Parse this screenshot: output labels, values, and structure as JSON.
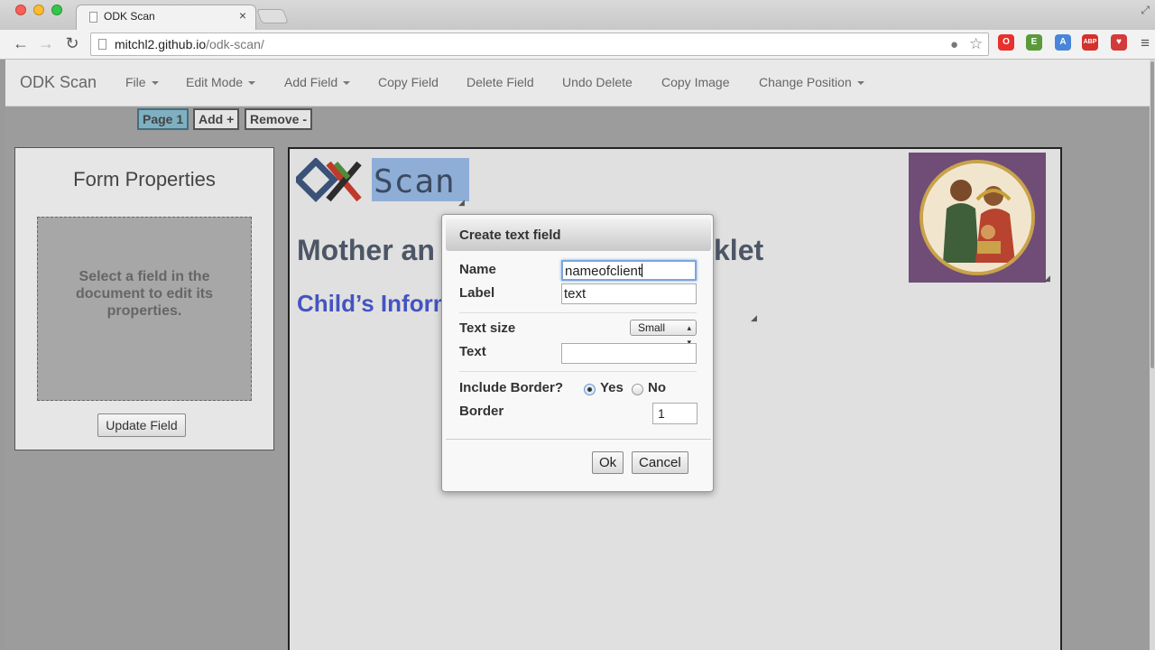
{
  "browser": {
    "tab_title": "ODK Scan",
    "tab_close": "×",
    "url_host": "mitchl2.github.io",
    "url_path": "/odk-scan/",
    "extensions": [
      {
        "name": "opera-icon",
        "color": "#e8302e",
        "glyph": "O"
      },
      {
        "name": "evernote-icon",
        "color": "#5a9a3b",
        "glyph": "E"
      },
      {
        "name": "translate-icon",
        "color": "#4a86d8",
        "glyph": "A"
      },
      {
        "name": "adblock-icon",
        "color": "#d4312a",
        "glyph": "ABP"
      },
      {
        "name": "heart-icon",
        "color": "#d43a3a",
        "glyph": "♥"
      }
    ]
  },
  "app": {
    "brand": "ODK Scan",
    "menu": [
      {
        "label": "File",
        "dropdown": true
      },
      {
        "label": "Edit Mode",
        "dropdown": true
      },
      {
        "label": "Add Field",
        "dropdown": true
      },
      {
        "label": "Copy Field",
        "dropdown": false
      },
      {
        "label": "Delete Field",
        "dropdown": false
      },
      {
        "label": "Undo Delete",
        "dropdown": false
      },
      {
        "label": "Copy Image",
        "dropdown": false
      },
      {
        "label": "Change Position",
        "dropdown": true
      }
    ],
    "page_buttons": {
      "page": "Page 1",
      "add": "Add +",
      "remove": "Remove -"
    }
  },
  "properties": {
    "title": "Form Properties",
    "hint": "Select a field in the document to edit its properties.",
    "update_button": "Update Field"
  },
  "document": {
    "logo_text": "Scan",
    "heading_left": "Mother an",
    "heading_right": "klet",
    "subheading": "Child’s Inform"
  },
  "dialog": {
    "title": "Create text field",
    "name_label": "Name",
    "name_value": "nameofclient",
    "label_label": "Label",
    "label_value": "text",
    "text_size_label": "Text size",
    "text_size_value": "Small",
    "text_label": "Text",
    "text_value": "",
    "include_border_label": "Include Border?",
    "yes_label": "Yes",
    "no_label": "No",
    "border_selected": "Yes",
    "border_label": "Border",
    "border_value": "1",
    "ok_label": "Ok",
    "cancel_label": "Cancel"
  }
}
